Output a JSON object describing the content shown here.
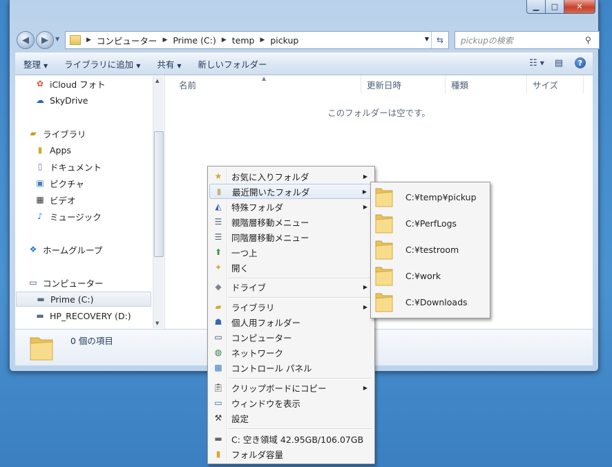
{
  "window": {
    "controls": {
      "minimize": "▁",
      "maximize": "□",
      "close": "✕"
    }
  },
  "address_bar": {
    "segments": [
      "コンピューター",
      "Prime (C:)",
      "temp",
      "pickup"
    ],
    "search_placeholder": "pickupの検索"
  },
  "toolbar": {
    "organize": "整理",
    "add_to_library": "ライブラリに追加",
    "share": "共有",
    "new_folder": "新しいフォルダー"
  },
  "nav_pane": {
    "items": [
      {
        "label": "iCloud フォト",
        "icon": "icloud-photos-icon"
      },
      {
        "label": "SkyDrive",
        "icon": "skydrive-icon"
      },
      {
        "label": "ライブラリ",
        "icon": "library-icon"
      },
      {
        "label": "Apps",
        "icon": "folder-icon"
      },
      {
        "label": "ドキュメント",
        "icon": "document-icon"
      },
      {
        "label": "ピクチャ",
        "icon": "picture-icon"
      },
      {
        "label": "ビデオ",
        "icon": "video-icon"
      },
      {
        "label": "ミュージック",
        "icon": "music-icon"
      },
      {
        "label": "ホームグループ",
        "icon": "homegroup-icon"
      },
      {
        "label": "コンピューター",
        "icon": "computer-icon"
      },
      {
        "label": "Prime (C:)",
        "icon": "drive-icon"
      },
      {
        "label": "HP_RECOVERY (D:)",
        "icon": "drive-icon"
      }
    ]
  },
  "content": {
    "columns": [
      "名前",
      "更新日時",
      "種類",
      "サイズ"
    ],
    "empty_message": "このフォルダーは空です。"
  },
  "details_pane": {
    "item_count": "0 個の項目"
  },
  "context_menu": {
    "items": [
      {
        "label": "お気に入りフォルダ",
        "submenu": true
      },
      {
        "label": "最近開いたフォルダ",
        "submenu": true,
        "highlighted": true
      },
      {
        "label": "特殊フォルダ",
        "submenu": true
      },
      {
        "label": "親階層移動メニュー",
        "submenu": false
      },
      {
        "label": "同階層移動メニュー",
        "submenu": false
      },
      {
        "label": "一つ上",
        "submenu": false
      },
      {
        "label": "開く",
        "submenu": false
      },
      {
        "label": "ドライブ",
        "submenu": true
      },
      {
        "label": "ライブラリ",
        "submenu": true
      },
      {
        "label": "個人用フォルダー",
        "submenu": false
      },
      {
        "label": "コンピューター",
        "submenu": false
      },
      {
        "label": "ネットワーク",
        "submenu": false
      },
      {
        "label": "コントロール パネル",
        "submenu": false
      },
      {
        "label": "クリップボードにコピー",
        "submenu": true
      },
      {
        "label": "ウィンドウを表示",
        "submenu": false
      },
      {
        "label": "設定",
        "submenu": false
      },
      {
        "label": "C: 空き領域 42.95GB/106.07GB",
        "submenu": false
      },
      {
        "label": "フォルダ容量",
        "submenu": false
      }
    ]
  },
  "recent_folders_submenu": {
    "items": [
      "C:¥temp¥pickup",
      "C:¥PerfLogs",
      "C:¥testroom",
      "C:¥work",
      "C:¥Downloads"
    ]
  }
}
